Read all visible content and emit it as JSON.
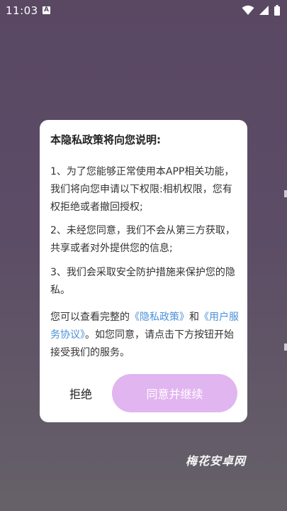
{
  "status_bar": {
    "time": "11:03",
    "notification_icon": "a-notification-icon",
    "icons": [
      "wifi-icon",
      "signal-icon",
      "battery-icon"
    ]
  },
  "dialog": {
    "title": "本隐私政策将向您说明:",
    "paragraph_1": "1、为了您能够正常使用本APP相关功能，我们将向您申请以下权限:相机权限，您有权拒绝或者撤回授权;",
    "paragraph_2": "2、未经您同意，我们不会从第三方获取，共享或者对外提供您的信息;",
    "paragraph_3": "3、我们会采取安全防护措施来保护您的隐私。",
    "notice_prefix": "您可以查看完整的",
    "privacy_link": "《隐私政策》",
    "notice_and": "和",
    "agreement_link": "《用户服务协议》",
    "notice_suffix": "。如您同意，请点击下方按钮开始接受我们的服务。",
    "reject_label": "拒绝",
    "agree_label": "同意并继续"
  },
  "watermark": "梅花安卓网",
  "colors": {
    "background_top": "#5a4863",
    "background_bottom": "#666168",
    "link": "#4a90d9",
    "agree_button": "#e1b5f0"
  }
}
